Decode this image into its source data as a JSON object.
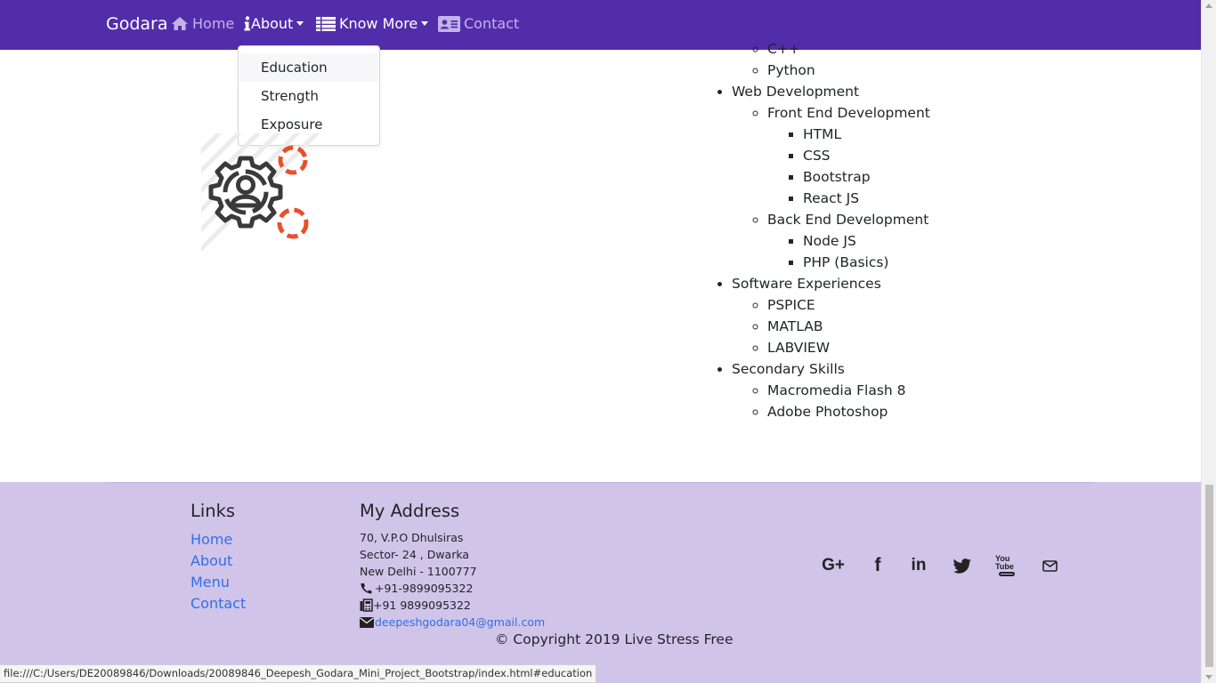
{
  "navbar": {
    "brand": "Godara",
    "home": "Home",
    "about": "About",
    "know_more": "Know More",
    "contact": "Contact",
    "background_color": "#522daa"
  },
  "about_dropdown": {
    "items": [
      "Education",
      "Strength",
      "Exposure"
    ]
  },
  "skills": {
    "partial_item": "C++",
    "python": "Python",
    "web_development": "Web Development",
    "front_end": "Front End Development",
    "front_end_items": [
      "HTML",
      "CSS",
      "Bootstrap",
      "React JS"
    ],
    "back_end": "Back End Development",
    "back_end_items": [
      "Node JS",
      "PHP (Basics)"
    ],
    "software_experiences": "Software Experiences",
    "software_items": [
      "PSPICE",
      "MATLAB",
      "LABVIEW"
    ],
    "secondary_skills": "Secondary Skills",
    "secondary_items": [
      "Macromedia Flash 8",
      "Adobe Photoshop"
    ]
  },
  "footer": {
    "background_color": "#d1c4e9",
    "links_heading": "Links",
    "links": [
      "Home",
      "About",
      "Menu",
      "Contact"
    ],
    "address_heading": "My Address",
    "address_line1": "70, V.P.O Dhulsiras",
    "address_line2": "Sector- 24 , Dwarka",
    "address_line3": "New Delhi - 1100777",
    "phone": "+91-9899095322",
    "fax": "+91 9899095322",
    "email": "deepeshgodara04@gmail.com",
    "copyright": "© Copyright 2019 Live Stress Free",
    "social_icons": [
      "google-plus-icon",
      "facebook-icon",
      "linkedin-icon",
      "twitter-icon",
      "youtube-icon",
      "envelope-icon"
    ],
    "youtube_text": "You Tube"
  },
  "status_bar": {
    "url": "file:///C:/Users/DE20089846/Downloads/20089846_Deepesh_Godara_Mini_Project_Bootstrap/index.html#education"
  }
}
